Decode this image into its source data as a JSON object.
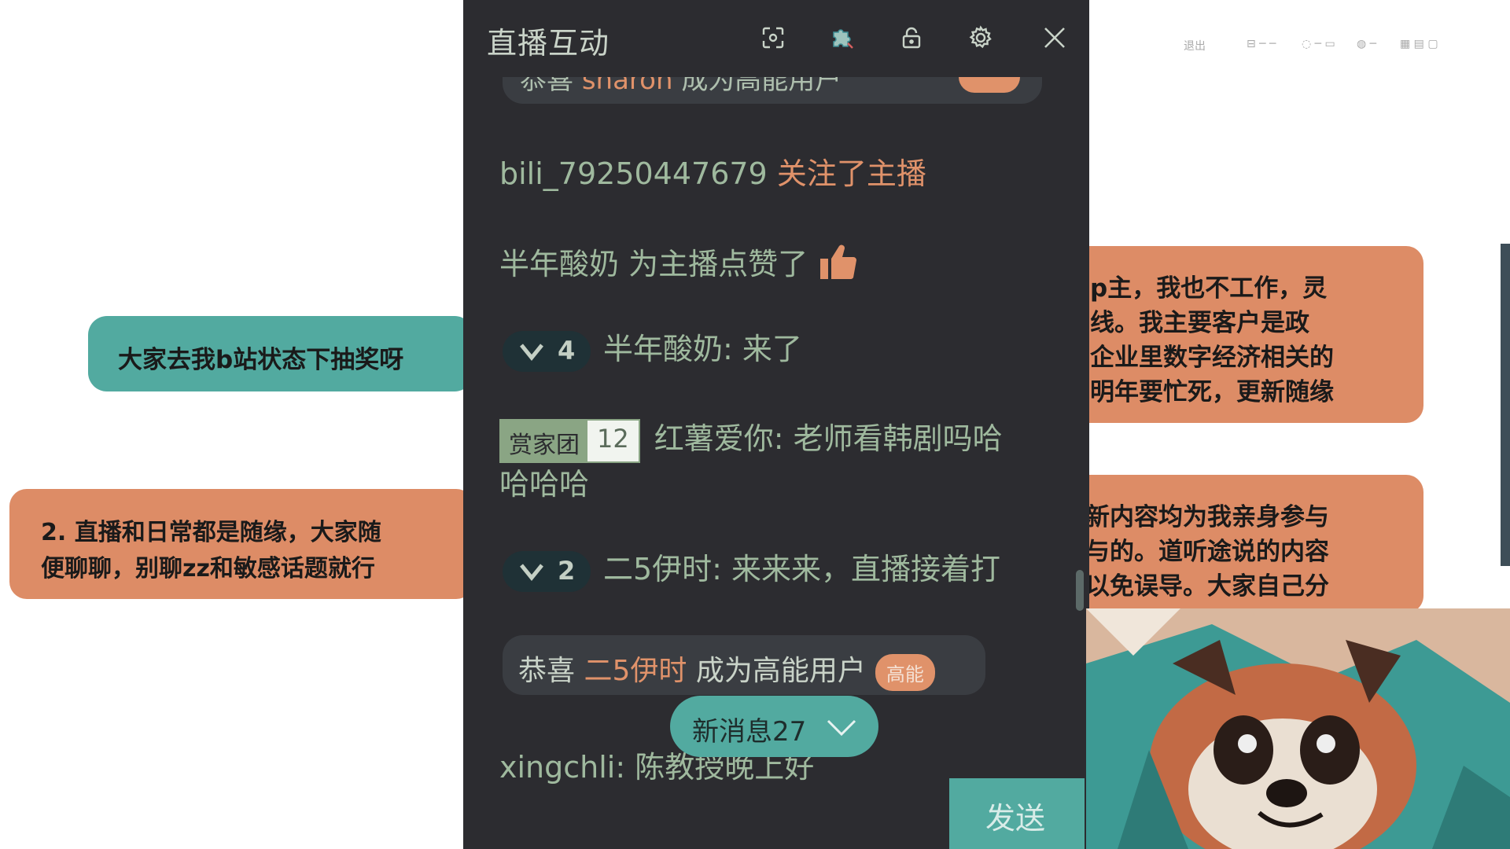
{
  "panel": {
    "title": "直播互动",
    "icons": [
      "shrink-icon",
      "puzzle-icon",
      "lock-icon",
      "settings-icon",
      "close-icon"
    ]
  },
  "messages": {
    "m0_partial": {
      "prefix": "恭喜",
      "user": "sharon",
      "suffix": "成为高能用户"
    },
    "m1": {
      "user": "bili_79250447679",
      "action": "关注了主播"
    },
    "m2": {
      "user": "半年酸奶",
      "action": "为主播点赞了"
    },
    "m3": {
      "level": "4",
      "text": "半年酸奶: 来了"
    },
    "m4": {
      "fan_name": "赏家团",
      "fan_level": "12",
      "line1": "红薯爱你: 老师看韩剧吗哈",
      "line2": "哈哈哈"
    },
    "m5": {
      "level": "2",
      "text": "二5伊时: 来来来，直播接着打"
    },
    "m6": {
      "prefix": "恭喜",
      "user": "二5伊时",
      "suffix": "成为高能用户",
      "tag": "高能"
    },
    "m7": {
      "text": "xingchli: 陈教授晚上好"
    }
  },
  "new_messages": {
    "label": "新消息27"
  },
  "send": {
    "label": "发送"
  },
  "stickers": {
    "lottery": "大家去我b站状态下抽奖呀",
    "rules_line1": "2. 直播和日常都是随缘，大家随",
    "rules_line2": "便聊聊，别聊zz和敏感话题就行",
    "intro_line1": "p主，我也不工作，灵",
    "intro_line2": "线。我主要客户是政",
    "intro_line3": "企业里数字经济相关的",
    "intro_line4": "明年要忙死，更新随缘",
    "note_line1": "新内容均为我亲身参与",
    "note_line2": "与的。道听途说的内容",
    "note_line3": "以免误导。大家自己分"
  },
  "toolbar": {
    "exit": "退出"
  },
  "colors": {
    "panel_bg": "#2c2c30",
    "teal": "#52aaa0",
    "orange": "#dd8c66",
    "accent_text": "#e0926a"
  }
}
